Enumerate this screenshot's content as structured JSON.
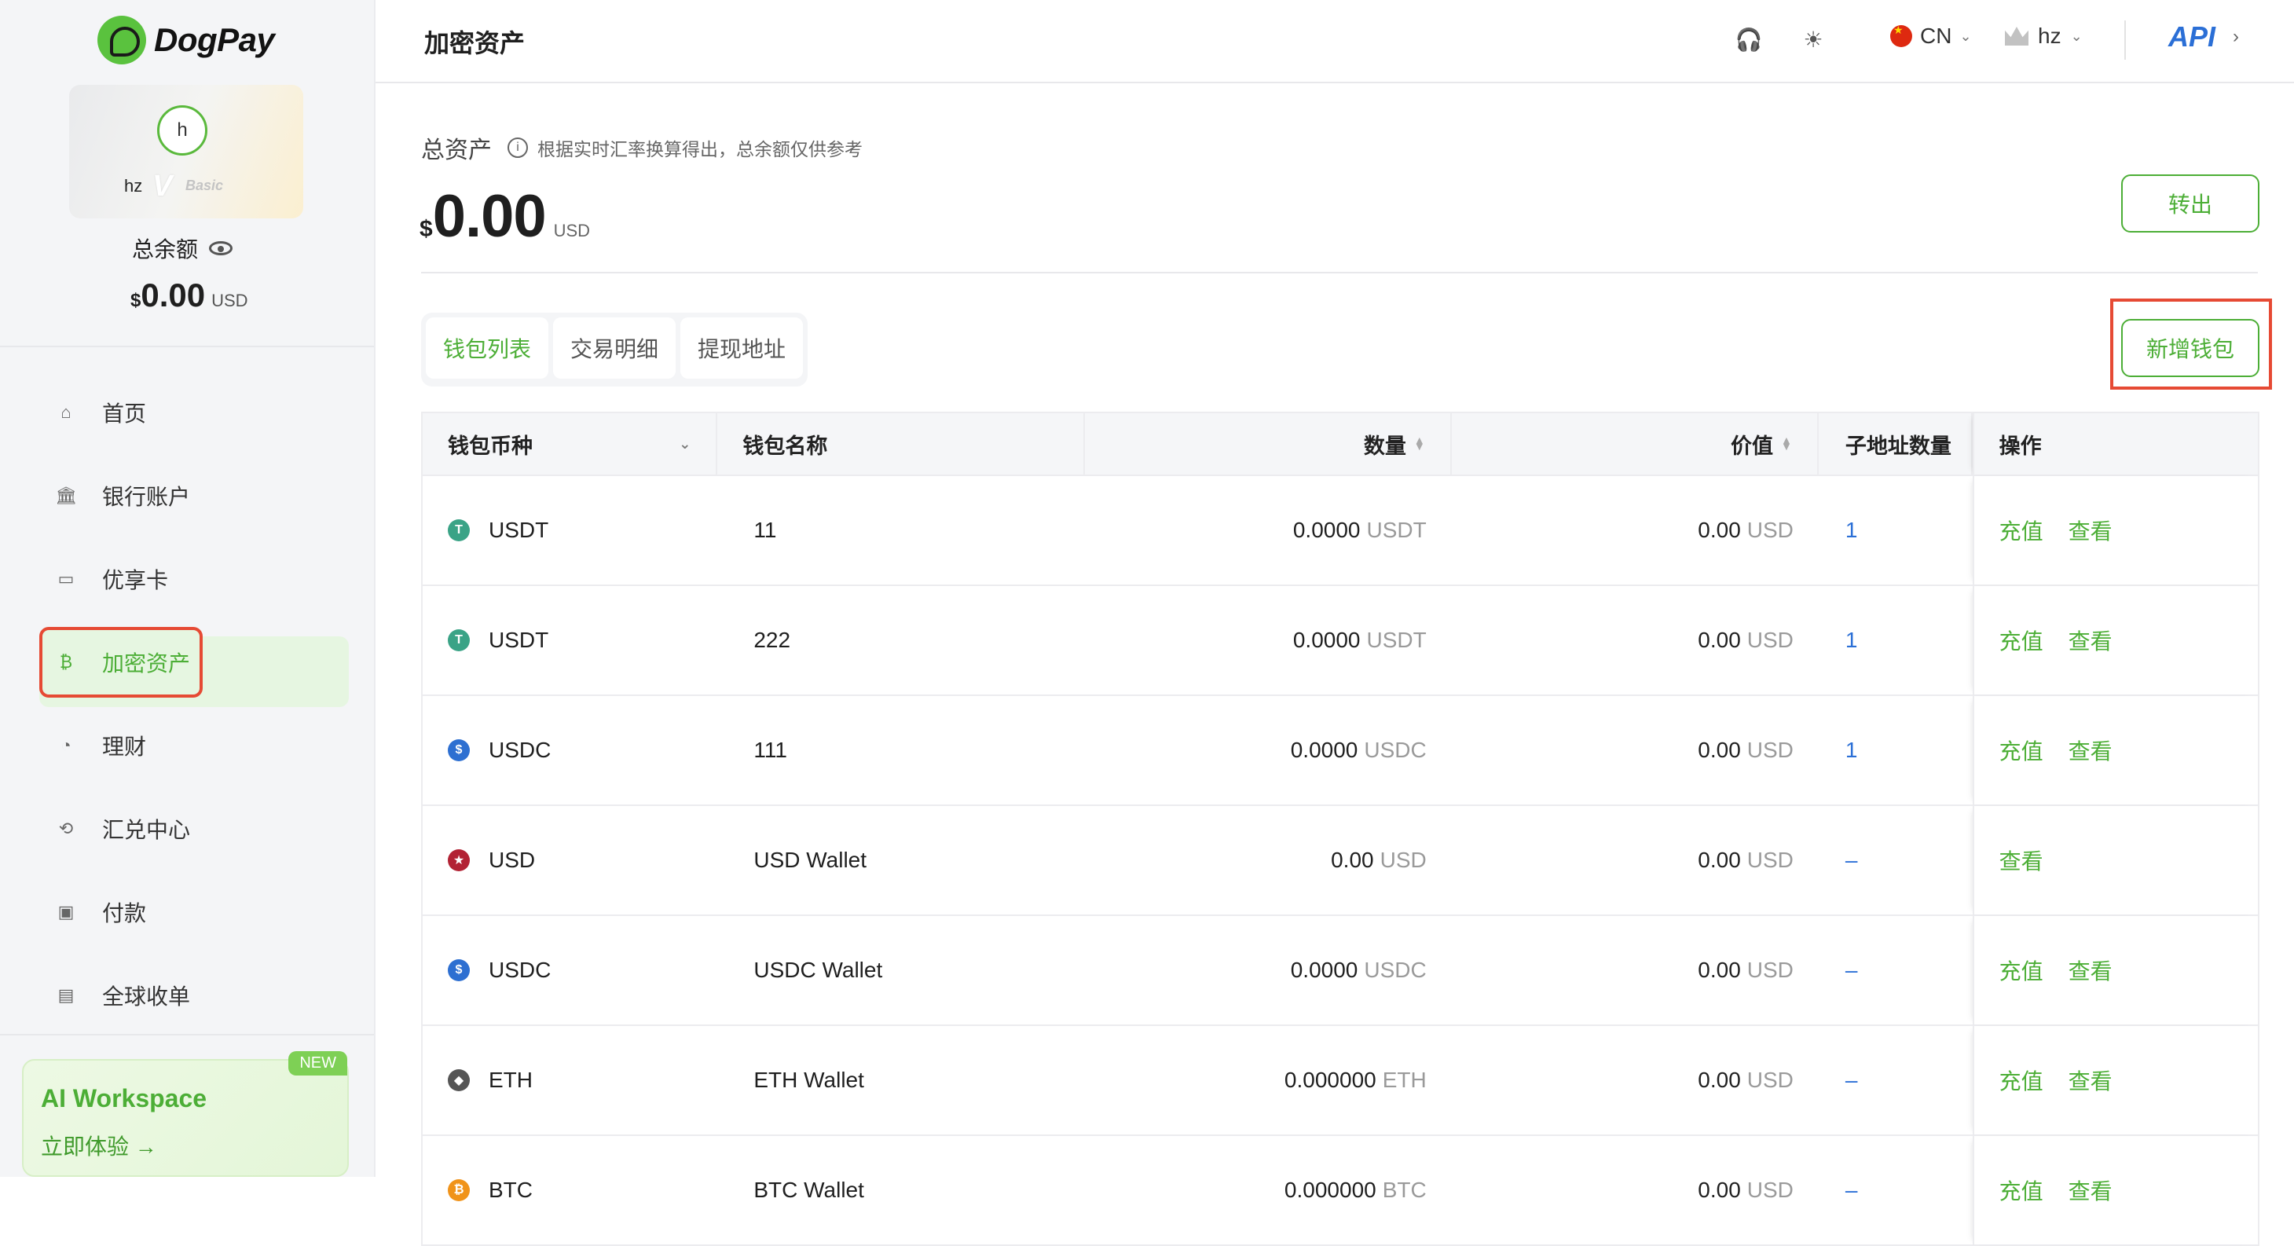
{
  "brand": {
    "name": "DogPay"
  },
  "user": {
    "avatar_letter": "h",
    "name": "hz",
    "tier_v": "V",
    "tier": "Basic"
  },
  "sidebar_balance": {
    "label": "总余额",
    "currency_symbol": "$",
    "value": "0.00",
    "unit": "USD"
  },
  "nav": [
    {
      "label": "首页",
      "icon": "home-icon",
      "glyph": "⌂"
    },
    {
      "label": "银行账户",
      "icon": "bank-icon",
      "glyph": "🏛"
    },
    {
      "label": "优享卡",
      "icon": "card-icon",
      "glyph": "▭"
    },
    {
      "label": "加密资产",
      "icon": "bitcoin-icon",
      "glyph": "₿",
      "active": true
    },
    {
      "label": "理财",
      "icon": "finance-icon",
      "glyph": "◔"
    },
    {
      "label": "汇兑中心",
      "icon": "exchange-icon",
      "glyph": "⟲"
    },
    {
      "label": "付款",
      "icon": "wallet-icon",
      "glyph": "▣"
    },
    {
      "label": "全球收单",
      "icon": "receipt-icon",
      "glyph": "▤"
    }
  ],
  "ai_card": {
    "badge": "NEW",
    "title": "AI Workspace",
    "cta": "立即体验 →"
  },
  "header": {
    "title": "加密资产",
    "lang": "CN",
    "username": "hz",
    "api_label": "API"
  },
  "total": {
    "label": "总资产",
    "note": "根据实时汇率换算得出，总余额仅供参考",
    "currency_symbol": "$",
    "value": "0.00",
    "unit": "USD",
    "transfer_out": "转出"
  },
  "tabs": [
    {
      "label": "钱包列表",
      "active": true
    },
    {
      "label": "交易明细"
    },
    {
      "label": "提现地址"
    }
  ],
  "add_wallet": "新增钱包",
  "table": {
    "headers": [
      "钱包币种",
      "钱包名称",
      "数量",
      "价值",
      "子地址数量",
      "操作"
    ],
    "rows": [
      {
        "coin": "USDT",
        "name": "11",
        "qty": "0.0000",
        "qty_unit": "USDT",
        "value": "0.00",
        "value_unit": "USD",
        "sub": "1",
        "ops": [
          "充值",
          "查看"
        ],
        "icon_color": "#3aa386",
        "icon_glyph": "T"
      },
      {
        "coin": "USDT",
        "name": "222",
        "qty": "0.0000",
        "qty_unit": "USDT",
        "value": "0.00",
        "value_unit": "USD",
        "sub": "1",
        "ops": [
          "充值",
          "查看"
        ],
        "icon_color": "#3aa386",
        "icon_glyph": "T"
      },
      {
        "coin": "USDC",
        "name": "111",
        "qty": "0.0000",
        "qty_unit": "USDC",
        "value": "0.00",
        "value_unit": "USD",
        "sub": "1",
        "ops": [
          "充值",
          "查看"
        ],
        "icon_color": "#2d6fd1",
        "icon_glyph": "$"
      },
      {
        "coin": "USD",
        "name": "USD Wallet",
        "qty": "0.00",
        "qty_unit": "USD",
        "value": "0.00",
        "value_unit": "USD",
        "sub": "–",
        "ops": [
          "查看"
        ],
        "icon_color": "#b22234",
        "icon_glyph": "★"
      },
      {
        "coin": "USDC",
        "name": "USDC Wallet",
        "qty": "0.0000",
        "qty_unit": "USDC",
        "value": "0.00",
        "value_unit": "USD",
        "sub": "–",
        "ops": [
          "充值",
          "查看"
        ],
        "icon_color": "#2d6fd1",
        "icon_glyph": "$"
      },
      {
        "coin": "ETH",
        "name": "ETH Wallet",
        "qty": "0.000000",
        "qty_unit": "ETH",
        "value": "0.00",
        "value_unit": "USD",
        "sub": "–",
        "ops": [
          "充值",
          "查看"
        ],
        "icon_color": "#555555",
        "icon_glyph": "◆"
      },
      {
        "coin": "BTC",
        "name": "BTC Wallet",
        "qty": "0.000000",
        "qty_unit": "BTC",
        "value": "0.00",
        "value_unit": "USD",
        "sub": "–",
        "ops": [
          "充值",
          "查看"
        ],
        "icon_color": "#f0931a",
        "icon_glyph": "₿"
      }
    ]
  }
}
